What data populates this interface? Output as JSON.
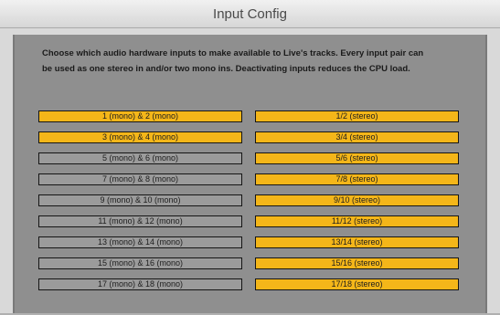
{
  "window": {
    "title": "Input Config"
  },
  "description": "Choose which audio hardware inputs to make available to Live's tracks. Every input pair can\nbe used as one stereo in and/or two mono ins.  Deactivating inputs reduces the CPU load.",
  "colors": {
    "active": "#f4b619",
    "inactive": "#9b9b9b",
    "panel": "#8f8f8f"
  },
  "rows": [
    {
      "mono": {
        "label": "1 (mono) & 2 (mono)",
        "active": true
      },
      "stereo": {
        "label": "1/2 (stereo)",
        "active": true
      }
    },
    {
      "mono": {
        "label": "3 (mono) & 4 (mono)",
        "active": true
      },
      "stereo": {
        "label": "3/4 (stereo)",
        "active": true
      }
    },
    {
      "mono": {
        "label": "5 (mono) & 6 (mono)",
        "active": false
      },
      "stereo": {
        "label": "5/6 (stereo)",
        "active": true
      }
    },
    {
      "mono": {
        "label": "7 (mono) & 8 (mono)",
        "active": false
      },
      "stereo": {
        "label": "7/8 (stereo)",
        "active": true
      }
    },
    {
      "mono": {
        "label": "9 (mono) & 10 (mono)",
        "active": false
      },
      "stereo": {
        "label": "9/10 (stereo)",
        "active": true
      }
    },
    {
      "mono": {
        "label": "11 (mono) & 12 (mono)",
        "active": false
      },
      "stereo": {
        "label": "11/12 (stereo)",
        "active": true
      }
    },
    {
      "mono": {
        "label": "13 (mono) & 14 (mono)",
        "active": false
      },
      "stereo": {
        "label": "13/14 (stereo)",
        "active": true
      }
    },
    {
      "mono": {
        "label": "15 (mono) & 16 (mono)",
        "active": false
      },
      "stereo": {
        "label": "15/16 (stereo)",
        "active": true
      }
    },
    {
      "mono": {
        "label": "17 (mono) & 18 (mono)",
        "active": false
      },
      "stereo": {
        "label": "17/18 (stereo)",
        "active": true
      }
    }
  ]
}
